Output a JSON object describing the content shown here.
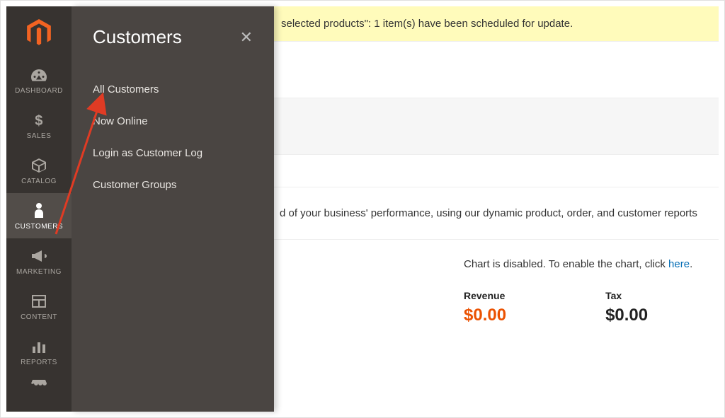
{
  "sidebar": {
    "items": [
      {
        "label": "DASHBOARD"
      },
      {
        "label": "SALES"
      },
      {
        "label": "CATALOG"
      },
      {
        "label": "CUSTOMERS"
      },
      {
        "label": "MARKETING"
      },
      {
        "label": "CONTENT"
      },
      {
        "label": "REPORTS"
      }
    ]
  },
  "submenu": {
    "title": "Customers",
    "close": "✕",
    "items": [
      "All Customers",
      "Now Online",
      "Login as Customer Log",
      "Customer Groups"
    ]
  },
  "notice": "selected products\": 1 item(s) have been scheduled for update.",
  "performance_text": "d of your business' performance, using our dynamic product, order, and customer reports",
  "chart_text": {
    "prefix": "Chart is disabled. To enable the chart, click ",
    "link": "here",
    "suffix": "."
  },
  "stats": [
    {
      "label": "Revenue",
      "value": "$0.00",
      "accent": true
    },
    {
      "label": "Tax",
      "value": "$0.00",
      "accent": false
    }
  ]
}
